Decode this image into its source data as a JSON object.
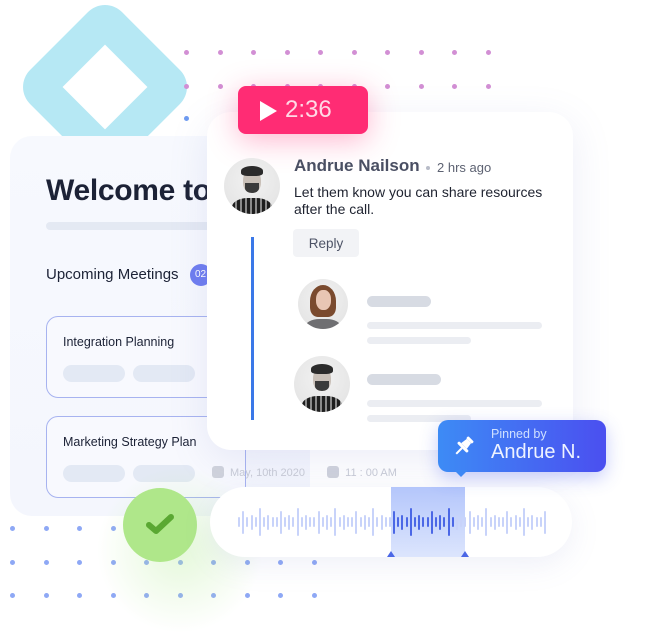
{
  "timer": {
    "label": "2:36",
    "icon": "play-icon",
    "color": "#ff2c74"
  },
  "left_panel": {
    "welcome": "Welcome to",
    "meetings_title": "Upcoming Meetings",
    "meetings_count": "02",
    "meetings": [
      {
        "name": "Integration Planning"
      },
      {
        "name": "Marketing Strategy Plan"
      }
    ],
    "date": "May, 10th 2020",
    "time": "11 : 00 AM"
  },
  "comment": {
    "author": "Andrue Nailson",
    "time_ago": "2 hrs ago",
    "text": "Let them know you can share resources after the call.",
    "reply_label": "Reply",
    "thread_color": "#3a78e8"
  },
  "pinned": {
    "by_label": "Pinned by",
    "name": "Andrue N.",
    "icon": "pin-icon"
  },
  "waveform": {
    "selection_range": [
      0.5,
      0.7
    ],
    "accent": "#4b67e6",
    "bar_heights": [
      0.3,
      0.8,
      0.3,
      0.5,
      0.3,
      1.0,
      0.3,
      0.5,
      0.3,
      0.3,
      0.8,
      0.3,
      0.5,
      0.3,
      1.0,
      0.3,
      0.5,
      0.3,
      0.3,
      0.8,
      0.3,
      0.5,
      0.3,
      1.0,
      0.3,
      0.5,
      0.3,
      0.3,
      0.8,
      0.3,
      0.5,
      0.3,
      1.0,
      0.3,
      0.5,
      0.3,
      0.3,
      0.8,
      0.3,
      0.5,
      0.3,
      1.0,
      0.3,
      0.5,
      0.3,
      0.3,
      0.8,
      0.3,
      0.5,
      0.3,
      1.0,
      0.3,
      0.5,
      0.3,
      0.3,
      0.8,
      0.3,
      0.5,
      0.3,
      1.0,
      0.3,
      0.5,
      0.3,
      0.3,
      0.8,
      0.3,
      0.5,
      0.3,
      1.0,
      0.3,
      0.5,
      0.3,
      0.3,
      0.8
    ]
  },
  "status": {
    "icon": "check-icon",
    "color": "#afe78a"
  }
}
